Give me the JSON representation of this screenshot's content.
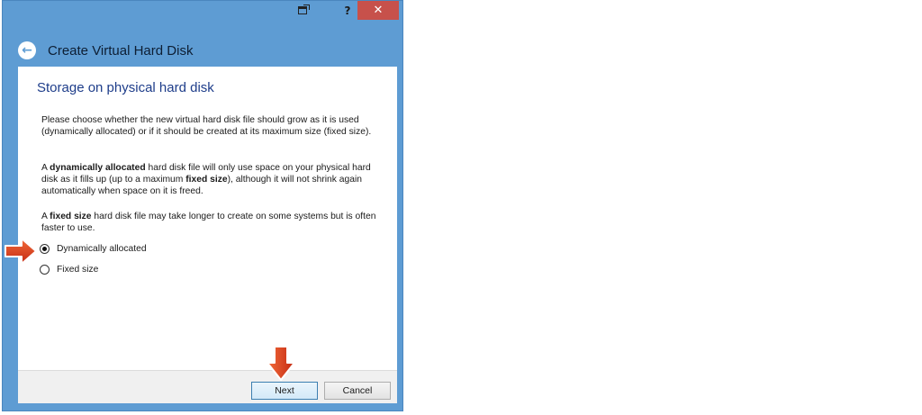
{
  "window": {
    "title": "Create Virtual Hard Disk",
    "controls": {
      "help": "?",
      "close": "✕"
    }
  },
  "page": {
    "section_title": "Storage on physical hard disk",
    "paragraph1": "Please choose whether the new virtual hard disk file should grow as it is used (dynamically allocated) or if it should be created at its maximum size (fixed size).",
    "paragraph2": {
      "pre": "A ",
      "bold1": "dynamically allocated",
      "mid1": " hard disk file will only use space on your physical hard disk as it fills up (up to a maximum ",
      "bold2": "fixed size",
      "post": "), although it will not shrink again automatically when space on it is freed."
    },
    "paragraph3": {
      "pre": "A ",
      "bold": "fixed size",
      "post": " hard disk file may take longer to create on some systems but is often faster to use."
    },
    "options": [
      {
        "label": "Dynamically allocated",
        "selected": true
      },
      {
        "label": "Fixed size",
        "selected": false
      }
    ]
  },
  "buttons": {
    "next": "Next",
    "cancel": "Cancel"
  },
  "colors": {
    "window_frame": "#5e9cd3",
    "close_button": "#c7514b",
    "section_title": "#1e3d8a",
    "annotation_arrow": "#d83a1e"
  },
  "annotations": [
    {
      "type": "arrow",
      "direction": "right",
      "target": "option-dynamically-allocated"
    },
    {
      "type": "arrow",
      "direction": "down",
      "target": "next-button"
    }
  ]
}
